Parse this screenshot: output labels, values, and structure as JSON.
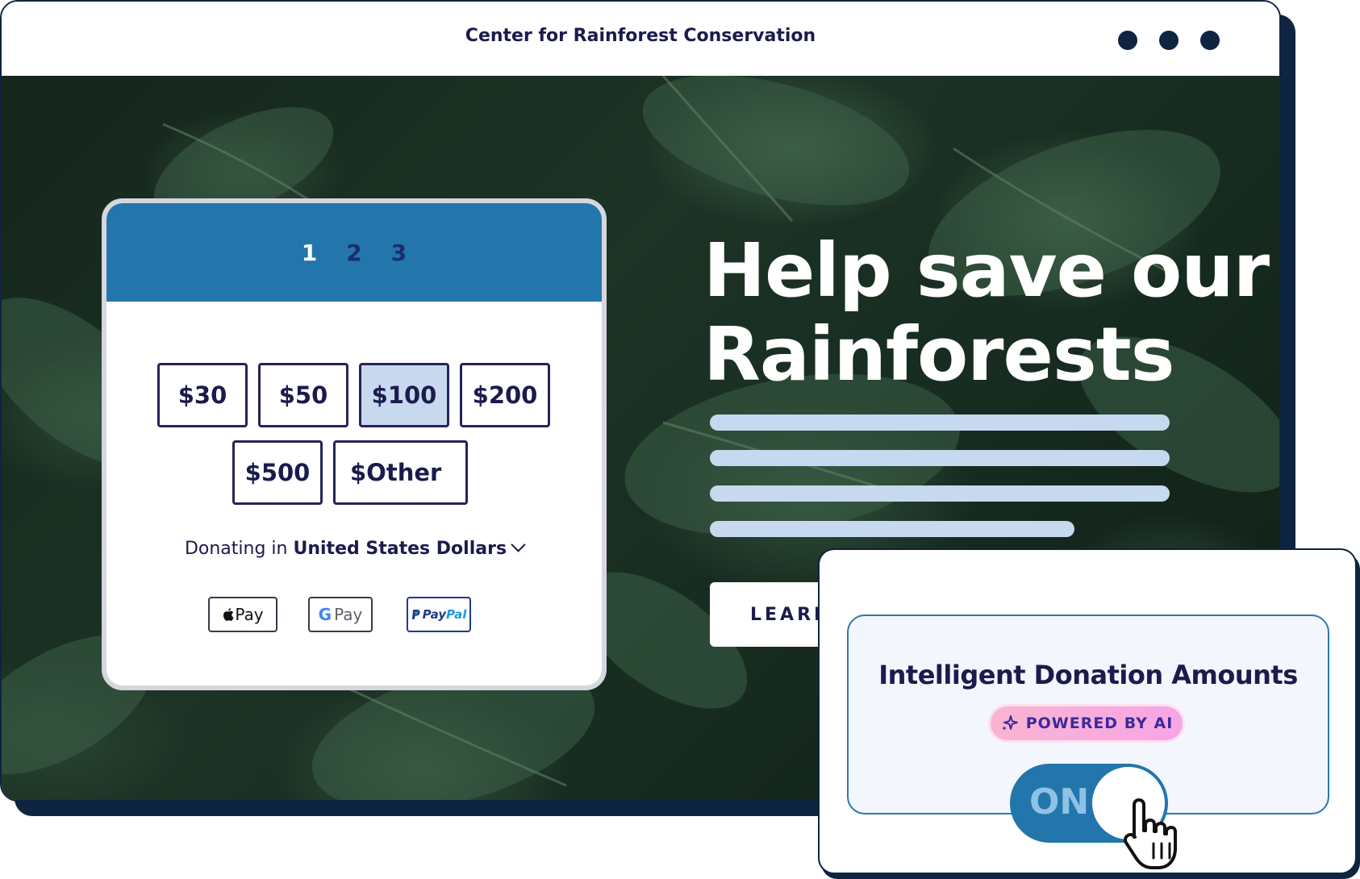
{
  "browser": {
    "site_title": "Center for Rainforest Conservation"
  },
  "hero": {
    "headline_line1": "Help save our",
    "headline_line2": "Rainforests",
    "learn_button": "LEARN"
  },
  "donation_form": {
    "steps": [
      "1",
      "2",
      "3"
    ],
    "active_step": 1,
    "amounts": [
      "$30",
      "$50",
      "$100",
      "$200",
      "$500",
      "$Other"
    ],
    "selected_amount": "$100",
    "currency_prefix": "Donating in",
    "currency_value": "United States Dollars",
    "payment_methods": {
      "apple_pay": "Pay",
      "google_pay": "Pay",
      "paypal_part1": "Pay",
      "paypal_part2": "Pal"
    }
  },
  "ai_card": {
    "title": "Intelligent Donation Amounts",
    "badge": "POWERED BY AI",
    "toggle_label": "ON",
    "toggle_state": "on"
  },
  "colors": {
    "navy": "#0f2440",
    "brand_blue": "#2276ab",
    "text_dark": "#1b1b4d",
    "selected_amount_bg": "#c8d8ef",
    "text_line_placeholder": "#c7d9ee",
    "badge_pink": "#f9b4d2"
  },
  "icons": [
    "window-dot-icon",
    "apple-icon",
    "google-g-icon",
    "paypal-p-icon",
    "sparkle-icon",
    "chevron-down-icon",
    "hand-pointer-cursor-icon"
  ]
}
